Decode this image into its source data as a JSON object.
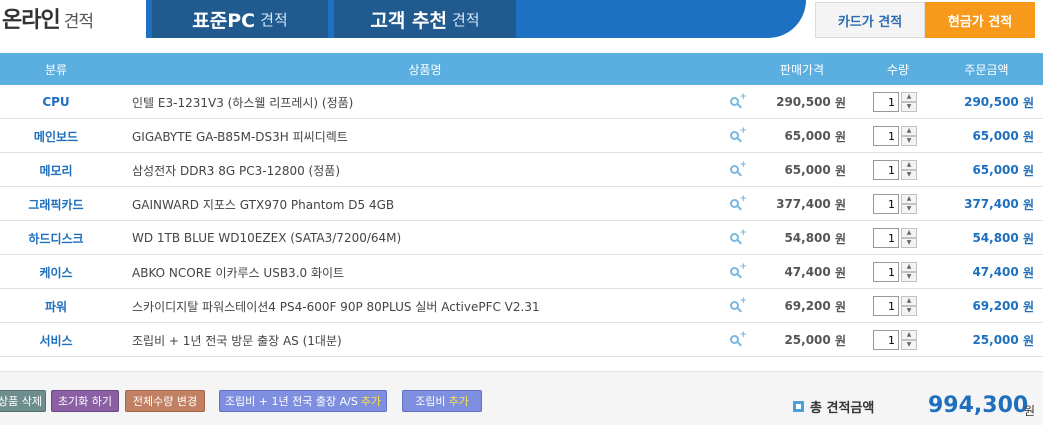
{
  "header": {
    "title_main": "온라인",
    "title_sub": "견적",
    "tabs": [
      {
        "label": "표준PC",
        "suffix": "견적"
      },
      {
        "label": "고객 추천",
        "suffix": "견적"
      }
    ],
    "price_tabs": {
      "card": "카드가 견적",
      "cash": "현금가 견적"
    }
  },
  "table": {
    "columns": {
      "category": "분류",
      "name": "상품명",
      "price": "판매가격",
      "qty": "수량",
      "total": "주문금액"
    },
    "currency_unit": "원",
    "rows": [
      {
        "category": "CPU",
        "name": "인텔 E3-1231V3 (하스웰 리프레시) (정품)",
        "price": "290,500",
        "qty": "1",
        "total": "290,500"
      },
      {
        "category": "메인보드",
        "name": "GIGABYTE GA-B85M-DS3H 피씨디렉트",
        "price": "65,000",
        "qty": "1",
        "total": "65,000"
      },
      {
        "category": "메모리",
        "name": "삼성전자 DDR3 8G PC3-12800 (정품)",
        "price": "65,000",
        "qty": "1",
        "total": "65,000"
      },
      {
        "category": "그래픽카드",
        "name": "GAINWARD 지포스 GTX970 Phantom D5 4GB",
        "price": "377,400",
        "qty": "1",
        "total": "377,400"
      },
      {
        "category": "하드디스크",
        "name": "WD 1TB BLUE WD10EZEX (SATA3/7200/64M)",
        "price": "54,800",
        "qty": "1",
        "total": "54,800"
      },
      {
        "category": "케이스",
        "name": "ABKO NCORE 이카루스 USB3.0 화이트",
        "price": "47,400",
        "qty": "1",
        "total": "47,400"
      },
      {
        "category": "파워",
        "name": "스카이디지탈 파워스테이션4 PS4-600F 90P 80PLUS 실버 ActivePFC V2.31",
        "price": "69,200",
        "qty": "1",
        "total": "69,200"
      },
      {
        "category": "서비스",
        "name": "조립비 + 1년 전국 방문 출장 AS (1대분)",
        "price": "25,000",
        "qty": "1",
        "total": "25,000"
      }
    ]
  },
  "footer": {
    "delete_label": "상품 삭제",
    "reset_label": "초기화 하기",
    "qty_change_label": "전체수량 변경",
    "add_as": {
      "label": "조립비 + 1년 전국 출장 A/S",
      "highlight": "추가"
    },
    "add_assembly": {
      "label": "조립비",
      "highlight": "추가"
    },
    "total_label": "총 견적금액",
    "total_amount": "994,300",
    "total_unit": "원"
  },
  "colors": {
    "brand_blue": "#1d70c2",
    "header_row": "#5bafe0",
    "accent_orange": "#f79a1c",
    "link_blue": "#1e6fbe"
  }
}
